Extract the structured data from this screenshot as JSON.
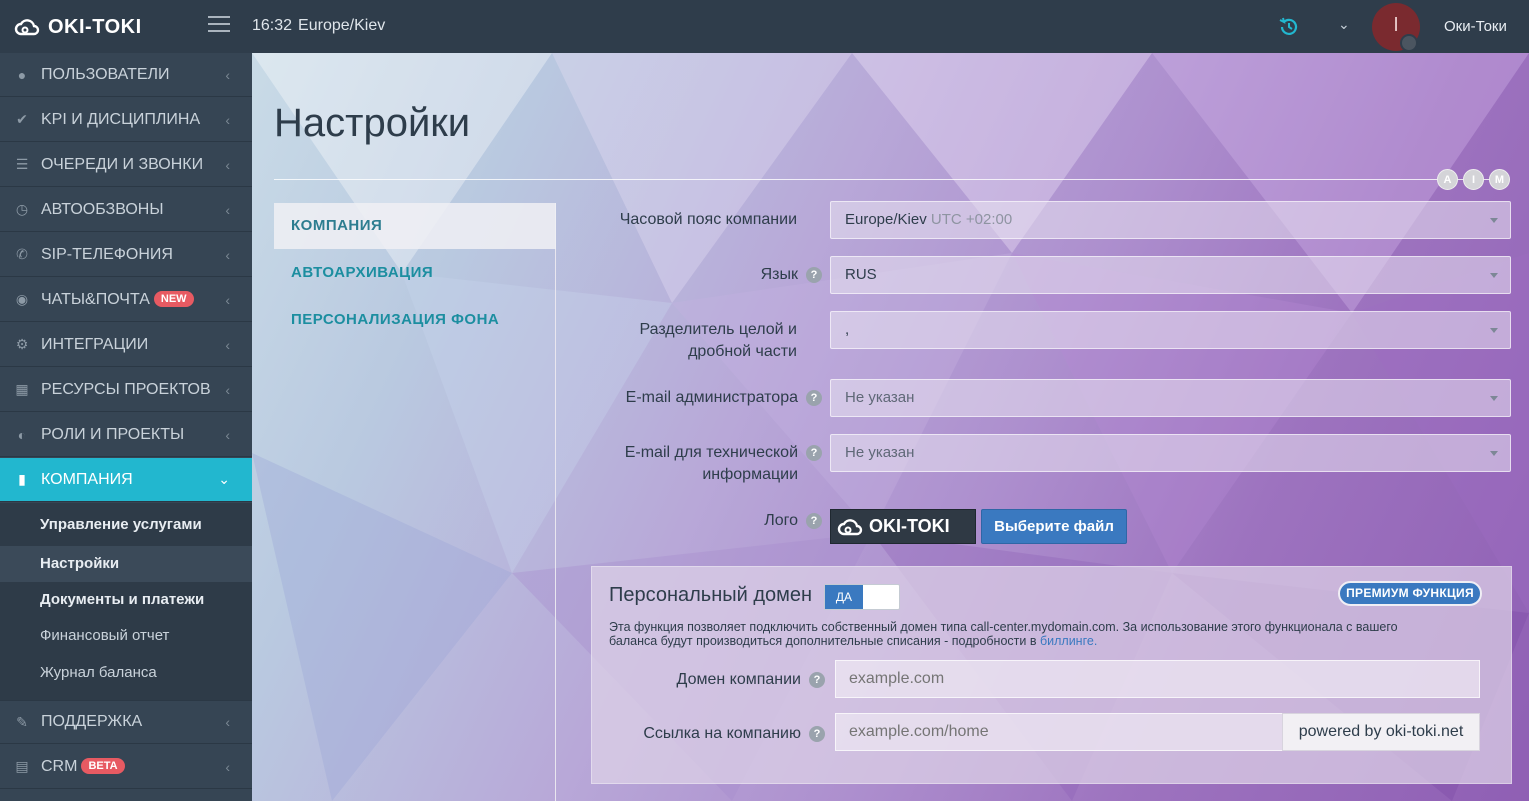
{
  "header": {
    "logo_text": "OKI-TOKI",
    "time": "16:32",
    "timezone": "Europe/Kiev",
    "avatar_letter": "I",
    "user_name": "Оки-Токи"
  },
  "sidebar": {
    "items": [
      {
        "label": "ПОЛЬЗОВАТЕЛИ",
        "icon": "user-icon"
      },
      {
        "label": "KPI И ДИСЦИПЛИНА",
        "icon": "check-icon"
      },
      {
        "label": "ОЧЕРЕДИ И ЗВОНКИ",
        "icon": "list-icon"
      },
      {
        "label": "АВТООБЗВОНЫ",
        "icon": "clock-icon"
      },
      {
        "label": "SIP-ТЕЛЕФОНИЯ",
        "icon": "phone-icon"
      },
      {
        "label": "ЧАТЫ&ПОЧТА",
        "icon": "chat-icon",
        "badge": "NEW"
      },
      {
        "label": "ИНТЕГРАЦИИ",
        "icon": "gears-icon"
      },
      {
        "label": "РЕСУРСЫ ПРОЕКТОВ",
        "icon": "grid-icon"
      },
      {
        "label": "РОЛИ И ПРОЕКТЫ",
        "icon": "toggle-icon"
      },
      {
        "label": "КОМПАНИЯ",
        "icon": "chart-icon"
      },
      {
        "label": "ПОДДЕРЖКА",
        "icon": "wrench-icon"
      },
      {
        "label": "CRM",
        "icon": "crm-icon",
        "badge": "BETA"
      }
    ],
    "subitems": [
      {
        "label": "Управление услугами"
      },
      {
        "label": "Настройки"
      },
      {
        "label": "Документы и платежи"
      },
      {
        "label": "Финансовый отчет"
      },
      {
        "label": "Журнал баланса"
      }
    ]
  },
  "page": {
    "title": "Настройки",
    "aim_buttons": [
      "A",
      "I",
      "M"
    ],
    "tabs": [
      "КОМПАНИЯ",
      "АВТОАРХИВАЦИЯ",
      "ПЕРСОНАЛИЗАЦИЯ ФОНА"
    ]
  },
  "form": {
    "timezone_label": "Часовой пояс компании",
    "timezone_value": "Europe/Kiev",
    "timezone_offset": "UTC +02:00",
    "language_label": "Язык",
    "language_value": "RUS",
    "separator_label_1": "Разделитель целой и",
    "separator_label_2": "дробной части",
    "separator_value": ",",
    "admin_email_label": "E-mail администратора",
    "admin_email_value": "Не указан",
    "tech_email_label_1": "E-mail для технической",
    "tech_email_label_2": "информации",
    "tech_email_value": "Не указан",
    "logo_label": "Лого",
    "logo_text": "OKI-TOKI",
    "file_button": "Выберите файл"
  },
  "domain_panel": {
    "title": "Персональный домен",
    "toggle_label": "ДА",
    "premium_badge": "ПРЕМИУМ ФУНКЦИЯ",
    "description_1": "Эта функция позволяет подключить собственный домен типа call-center.mydomain.com. За использование этого функционала с вашего",
    "description_2": "баланса будут производиться дополнительные списания - подробности в",
    "billing_link": "биллинге.",
    "domain_label": "Домен компании",
    "domain_placeholder": "example.com",
    "link_label": "Ссылка на компанию",
    "link_placeholder": "example.com/home",
    "link_addon": "powered by oki-toki.net"
  },
  "colors": {
    "accent": "#22b7cf",
    "primary_button": "#3a79c0",
    "badge_red": "#e75a62"
  }
}
